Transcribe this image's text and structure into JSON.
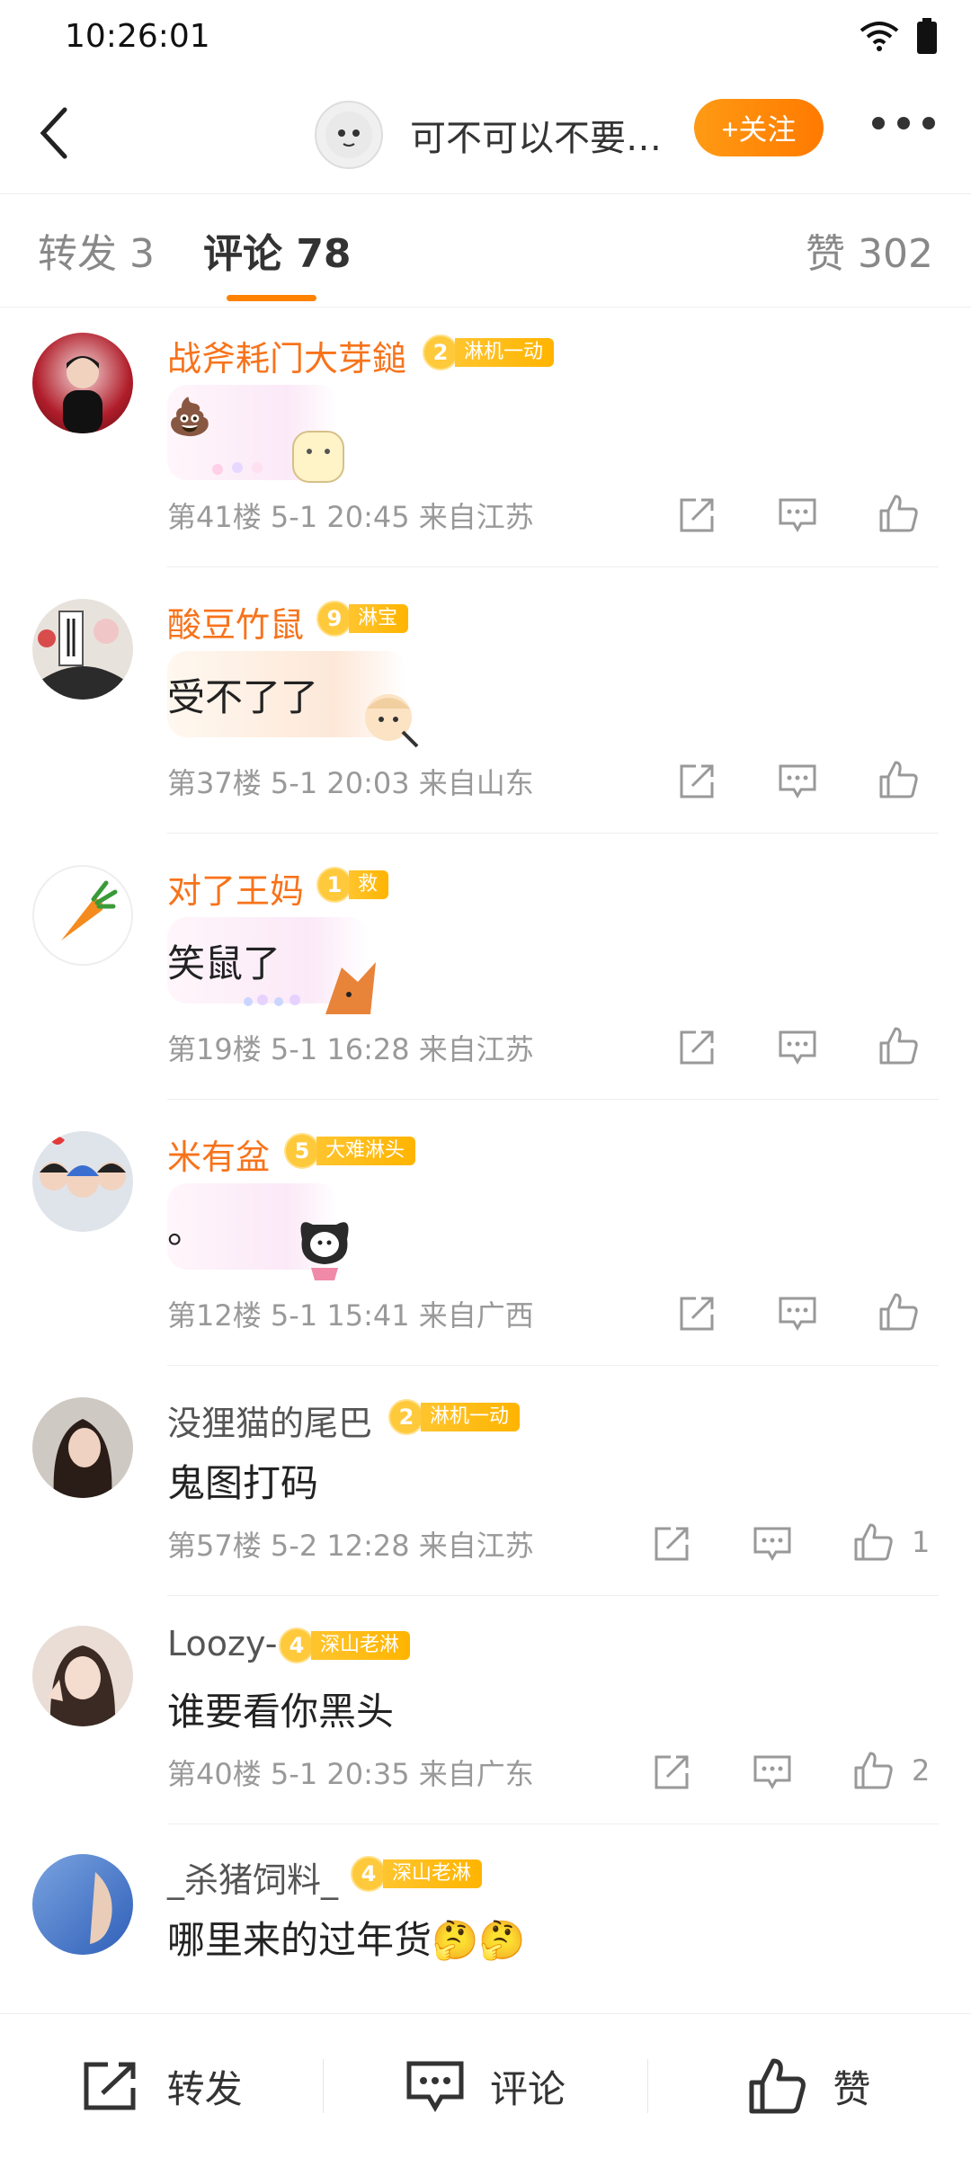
{
  "status": {
    "time": "10:26:01"
  },
  "header": {
    "title": "可不可以不要…",
    "follow_label": "+关注"
  },
  "tabs": {
    "repost": "转发 3",
    "comments": "评论 78",
    "likes": "赞 302"
  },
  "comments": [
    {
      "name": "战斧耗门大芽鎚",
      "level": "2",
      "badge": "淋机一动",
      "text": "💩",
      "floor": "第41楼",
      "time": "5-1 20:45",
      "location": "来自江苏",
      "likes": ""
    },
    {
      "name": "酸豆竹鼠",
      "level": "9",
      "badge": "淋宝",
      "text": "受不了了",
      "floor": "第37楼",
      "time": "5-1 20:03",
      "location": "来自山东",
      "likes": ""
    },
    {
      "name": "对了王妈",
      "level": "1",
      "badge": "救",
      "text": "笑鼠了",
      "floor": "第19楼",
      "time": "5-1 16:28",
      "location": "来自江苏",
      "likes": ""
    },
    {
      "name": "米有盆",
      "level": "5",
      "badge": "大难淋头",
      "text": "。",
      "floor": "第12楼",
      "time": "5-1 15:41",
      "location": "来自广西",
      "likes": ""
    },
    {
      "name": "没狸猫的尾巴",
      "level": "2",
      "badge": "淋机一动",
      "text": "鬼图打码",
      "floor": "第57楼",
      "time": "5-2 12:28",
      "location": "来自江苏",
      "likes": "1"
    },
    {
      "name": "Loozy-",
      "level": "4",
      "badge": "深山老淋",
      "text": "谁要看你黑头",
      "floor": "第40楼",
      "time": "5-1 20:35",
      "location": "来自广东",
      "likes": "2"
    },
    {
      "name": "_杀猪饲料_",
      "level": "4",
      "badge": "深山老淋",
      "text": "哪里来的过年货🤔🤔",
      "floor": "",
      "time": "",
      "location": "",
      "likes": ""
    }
  ],
  "bottom_bar": {
    "repost": "转发",
    "comment": "评论",
    "like": "赞"
  },
  "colors": {
    "accent": "#ff8200",
    "vip_name": "#f7731b"
  }
}
